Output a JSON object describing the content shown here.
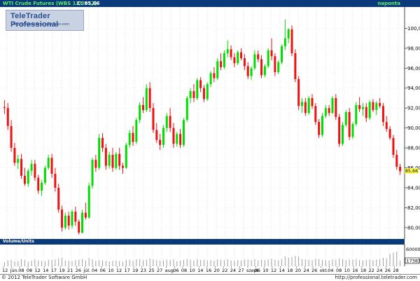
{
  "header": {
    "title": "WTI Crude Futures (WBS 12/2012)",
    "close_label": "C: 85,66",
    "period": "naponta"
  },
  "logo": {
    "text": "TeleTrader Professional",
    "url": "http://professional.teletrader.com"
  },
  "volume": {
    "label": "Volume/Units",
    "ticks": [
      "60000",
      "17383"
    ]
  },
  "footer": {
    "copyright": "© 2012 TeleTrader Software GmbH",
    "url": "http://professional.teletrader.com"
  },
  "colors": {
    "up": "#00dd00",
    "down": "#ee1111",
    "header_bg": "#0a3a7a",
    "last_price_bg": "#ffff55"
  },
  "chart_data": {
    "type": "candlestick",
    "last_price": "85,66",
    "y_axis": {
      "ylim": [
        79,
        102
      ],
      "ticks": [
        "80,00",
        "82,00",
        "84,00",
        "86,00",
        "88,00",
        "90,00",
        "92,00",
        "94,00",
        "96,00",
        "98,00",
        "100,00"
      ]
    },
    "x_ticks": [
      "12",
      "jún.",
      "08",
      "08",
      "12",
      "14",
      "17",
      "19",
      "21",
      "26",
      "júl.",
      "04",
      "06",
      "10",
      "12",
      "17",
      "19",
      "23",
      "25",
      "27",
      "aug.",
      "06",
      "08",
      "10",
      "14",
      "16",
      "20",
      "22",
      "24",
      "27",
      "szept.",
      "06",
      "10",
      "12",
      "14",
      "18",
      "20",
      "24",
      "26",
      "okt.",
      "04",
      "08",
      "10",
      "16",
      "18",
      "22",
      "24",
      "26",
      "28"
    ],
    "candles": [
      [
        92.1,
        92.8,
        91.4,
        92.0
      ],
      [
        92.0,
        92.5,
        89.8,
        90.2
      ],
      [
        90.2,
        90.8,
        87.6,
        88.0
      ],
      [
        88.0,
        88.5,
        86.2,
        86.5
      ],
      [
        86.5,
        87.3,
        85.9,
        86.9
      ],
      [
        86.9,
        87.4,
        84.9,
        85.2
      ],
      [
        85.2,
        86.0,
        84.2,
        84.4
      ],
      [
        84.4,
        85.9,
        84.1,
        85.7
      ],
      [
        85.7,
        86.8,
        85.2,
        86.4
      ],
      [
        86.4,
        86.8,
        84.7,
        85.0
      ],
      [
        85.0,
        85.3,
        83.4,
        83.7
      ],
      [
        83.7,
        84.8,
        83.2,
        84.5
      ],
      [
        84.5,
        86.2,
        84.3,
        86.0
      ],
      [
        86.0,
        87.3,
        85.8,
        87.0
      ],
      [
        87.0,
        87.4,
        85.0,
        85.4
      ],
      [
        85.4,
        86.0,
        83.6,
        84.0
      ],
      [
        84.0,
        84.4,
        81.5,
        81.8
      ],
      [
        81.8,
        82.2,
        79.6,
        80.0
      ],
      [
        80.0,
        81.5,
        79.8,
        81.2
      ],
      [
        81.2,
        81.6,
        79.8,
        80.2
      ],
      [
        80.2,
        81.8,
        79.9,
        81.6
      ],
      [
        81.6,
        82.1,
        80.2,
        80.6
      ],
      [
        80.6,
        80.8,
        79.3,
        79.5
      ],
      [
        79.5,
        81.8,
        79.4,
        81.5
      ],
      [
        81.5,
        82.5,
        80.8,
        81.0
      ],
      [
        81.0,
        84.5,
        80.9,
        84.2
      ],
      [
        84.2,
        87.0,
        83.9,
        86.8
      ],
      [
        86.8,
        87.3,
        85.6,
        86.0
      ],
      [
        86.0,
        89.4,
        85.8,
        89.0
      ],
      [
        89.0,
        89.5,
        87.6,
        88.0
      ],
      [
        88.0,
        88.4,
        85.8,
        86.2
      ],
      [
        86.2,
        87.6,
        85.9,
        87.3
      ],
      [
        87.3,
        88.0,
        85.6,
        86.0
      ],
      [
        86.0,
        87.6,
        85.8,
        87.4
      ],
      [
        87.4,
        88.0,
        85.8,
        86.2
      ],
      [
        86.2,
        86.5,
        85.4,
        86.0
      ],
      [
        86.0,
        88.5,
        85.9,
        88.3
      ],
      [
        88.3,
        89.8,
        88.0,
        89.5
      ],
      [
        89.5,
        90.2,
        88.2,
        88.6
      ],
      [
        88.6,
        91.0,
        88.4,
        90.8
      ],
      [
        90.8,
        92.6,
        90.5,
        92.3
      ],
      [
        92.3,
        93.1,
        91.5,
        91.8
      ],
      [
        91.8,
        94.4,
        91.6,
        94.0
      ],
      [
        94.0,
        94.6,
        91.6,
        92.0
      ],
      [
        92.0,
        92.5,
        89.5,
        89.8
      ],
      [
        89.8,
        90.5,
        88.5,
        88.8
      ],
      [
        88.8,
        89.4,
        87.8,
        88.3
      ],
      [
        88.3,
        90.3,
        88.0,
        90.0
      ],
      [
        90.0,
        91.5,
        89.6,
        91.2
      ],
      [
        91.2,
        92.0,
        89.6,
        90.0
      ],
      [
        90.0,
        90.5,
        88.0,
        88.4
      ],
      [
        88.4,
        89.6,
        88.1,
        89.4
      ],
      [
        89.4,
        89.9,
        88.0,
        88.3
      ],
      [
        88.3,
        91.0,
        88.1,
        90.8
      ],
      [
        90.8,
        93.2,
        90.6,
        93.0
      ],
      [
        93.0,
        94.0,
        92.5,
        93.7
      ],
      [
        93.7,
        94.4,
        92.6,
        93.0
      ],
      [
        93.0,
        95.0,
        92.8,
        94.8
      ],
      [
        94.8,
        95.1,
        93.6,
        94.0
      ],
      [
        94.0,
        94.3,
        92.6,
        92.9
      ],
      [
        92.9,
        94.6,
        92.7,
        94.4
      ],
      [
        94.4,
        95.7,
        94.1,
        95.5
      ],
      [
        95.5,
        96.1,
        94.6,
        95.0
      ],
      [
        95.0,
        97.0,
        94.8,
        96.7
      ],
      [
        96.7,
        97.5,
        95.8,
        96.1
      ],
      [
        96.1,
        97.8,
        95.9,
        97.5
      ],
      [
        97.5,
        98.8,
        97.1,
        97.9
      ],
      [
        97.9,
        98.3,
        96.8,
        97.1
      ],
      [
        97.1,
        97.5,
        96.1,
        96.5
      ],
      [
        96.5,
        97.8,
        96.3,
        97.6
      ],
      [
        97.6,
        98.0,
        96.8,
        97.0
      ],
      [
        97.0,
        97.4,
        95.8,
        96.2
      ],
      [
        96.2,
        96.6,
        94.9,
        95.2
      ],
      [
        95.2,
        96.2,
        94.8,
        96.0
      ],
      [
        96.0,
        97.8,
        95.8,
        97.4
      ],
      [
        97.4,
        97.8,
        96.6,
        96.9
      ],
      [
        96.9,
        97.3,
        95.0,
        95.3
      ],
      [
        95.3,
        96.4,
        95.1,
        96.2
      ],
      [
        96.2,
        98.0,
        96.0,
        97.8
      ],
      [
        97.8,
        99.0,
        96.8,
        97.2
      ],
      [
        97.2,
        97.5,
        95.2,
        95.6
      ],
      [
        95.6,
        96.8,
        95.4,
        96.6
      ],
      [
        96.6,
        98.4,
        96.4,
        98.2
      ],
      [
        98.2,
        100.9,
        97.8,
        99.0
      ],
      [
        99.0,
        100.0,
        98.5,
        99.9
      ],
      [
        99.9,
        100.3,
        97.2,
        97.5
      ],
      [
        97.5,
        97.9,
        94.6,
        94.9
      ],
      [
        94.9,
        95.2,
        91.8,
        92.2
      ],
      [
        92.2,
        93.0,
        91.5,
        92.6
      ],
      [
        92.6,
        93.0,
        91.2,
        91.5
      ],
      [
        91.5,
        93.2,
        91.3,
        93.0
      ],
      [
        93.0,
        93.4,
        91.9,
        92.2
      ],
      [
        92.2,
        92.5,
        90.3,
        90.6
      ],
      [
        90.6,
        90.9,
        89.0,
        89.3
      ],
      [
        89.3,
        91.5,
        89.1,
        91.2
      ],
      [
        91.2,
        92.3,
        91.0,
        92.0
      ],
      [
        92.0,
        92.3,
        91.2,
        91.5
      ],
      [
        91.5,
        93.2,
        91.4,
        93.0
      ],
      [
        93.0,
        93.4,
        90.8,
        91.1
      ],
      [
        91.1,
        91.4,
        88.1,
        88.4
      ],
      [
        88.4,
        90.6,
        88.2,
        90.3
      ],
      [
        90.3,
        91.8,
        90.1,
        91.6
      ],
      [
        91.6,
        92.0,
        88.8,
        89.1
      ],
      [
        89.1,
        90.6,
        88.9,
        90.4
      ],
      [
        90.4,
        92.6,
        90.2,
        92.3
      ],
      [
        92.3,
        93.1,
        91.6,
        91.9
      ],
      [
        91.9,
        92.5,
        91.2,
        92.1
      ],
      [
        92.1,
        92.5,
        90.6,
        91.0
      ],
      [
        91.0,
        92.8,
        90.8,
        92.6
      ],
      [
        92.6,
        92.9,
        91.6,
        91.8
      ],
      [
        91.8,
        92.7,
        91.3,
        92.5
      ],
      [
        92.5,
        93.0,
        92.0,
        92.2
      ],
      [
        92.2,
        92.5,
        90.2,
        90.6
      ],
      [
        90.6,
        91.2,
        89.6,
        89.9
      ],
      [
        89.9,
        90.2,
        88.8,
        89.0
      ],
      [
        89.0,
        89.3,
        87.0,
        87.3
      ],
      [
        87.3,
        87.8,
        85.8,
        86.1
      ],
      [
        86.1,
        86.4,
        85.3,
        85.66
      ]
    ],
    "volumes": [
      12000,
      18000,
      20000,
      15000,
      16000,
      22000,
      19000,
      14000,
      17000,
      21000,
      18000,
      16000,
      15000,
      20000,
      19000,
      21000,
      24000,
      26000,
      18000,
      17000,
      16000,
      19000,
      20000,
      22000,
      18000,
      25000,
      21000,
      17000,
      19000,
      18000,
      16000,
      15000,
      17000,
      18000,
      16000,
      14000,
      19000,
      20000,
      17000,
      21000,
      22000,
      18000,
      20000,
      23000,
      21000,
      19000,
      17000,
      18000,
      20000,
      19000,
      21000,
      16000,
      17000,
      19000,
      22000,
      20000,
      18000,
      21000,
      19000,
      20000,
      18000,
      19000,
      17000,
      21000,
      20000,
      19000,
      22000,
      18000,
      17000,
      19000,
      18000,
      20000,
      21000,
      19000,
      22000,
      18000,
      20000,
      19000,
      21000,
      23000,
      20000,
      18000,
      22000,
      30000,
      26000,
      28000,
      32000,
      30000,
      22000,
      21000,
      20000,
      19000,
      23000,
      22000,
      20000,
      19000,
      18000,
      21000,
      20000,
      24000,
      22000,
      19000,
      21000,
      20000,
      22000,
      19000,
      18000,
      20000,
      21000,
      19000,
      20000,
      22000,
      26000,
      24000,
      38000,
      42000,
      45000,
      17383
    ]
  }
}
